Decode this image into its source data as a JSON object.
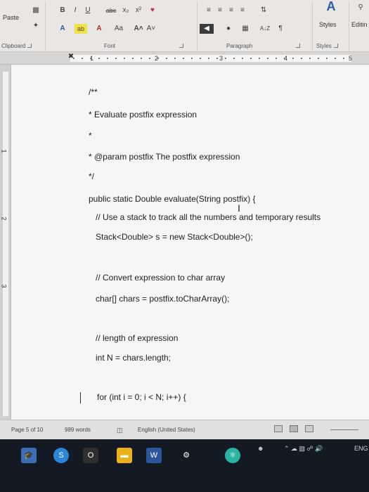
{
  "ribbon": {
    "clipboard": {
      "paste_label": "Paste",
      "group_label": "Clipboard"
    },
    "font": {
      "group_label": "Font",
      "bold": "B",
      "italic": "I",
      "underline": "U",
      "strike": "abc",
      "subscript": "x₂",
      "superscript": "x²",
      "text_effects": "A",
      "highlight": "ab",
      "font_color": "A",
      "change_case": "Aa",
      "grow": "A˄",
      "shrink": "A˅"
    },
    "paragraph": {
      "group_label": "Paragraph",
      "sort": "A↓Z",
      "pilcrow": "¶"
    },
    "styles": {
      "styles_label": "Styles",
      "group_label": "Styles"
    },
    "editing": {
      "label": "Editin"
    }
  },
  "ruler": {
    "numbers": [
      "1",
      "2",
      "3",
      "4",
      "5"
    ]
  },
  "vruler": {
    "numbers": [
      "1",
      "2",
      "3"
    ]
  },
  "document": {
    "lines": [
      {
        "text": "/**"
      },
      {
        "text": "* Evaluate postfix expression"
      },
      {
        "text": "*"
      },
      {
        "text": "* @param postfix The postfix expression"
      },
      {
        "text": "*/"
      },
      {
        "text": "public static Double evaluate(String postfix) {"
      },
      {
        "text": "// Use a stack to track all the numbers and temporary results"
      },
      {
        "text": "Stack<Double> s = new Stack<Double>();"
      },
      {
        "text": "// Convert expression to char array"
      },
      {
        "text": "char[] chars = postfix.toCharArray();"
      },
      {
        "text": "// length of expression"
      },
      {
        "text": "int N = chars.length;"
      },
      {
        "text": "for (int i = 0; i < N; i++) {"
      }
    ]
  },
  "status": {
    "page": "Page 5 of 10",
    "words": "989 words",
    "language": "English (United States)"
  },
  "taskbar": {
    "tray_text": "ENG"
  },
  "colors": {
    "ribbon_bg": "#e9e6e4",
    "page_bg": "#f7f6f4",
    "taskbar_bg": "#141a24",
    "spell_error": "#cc3333"
  }
}
